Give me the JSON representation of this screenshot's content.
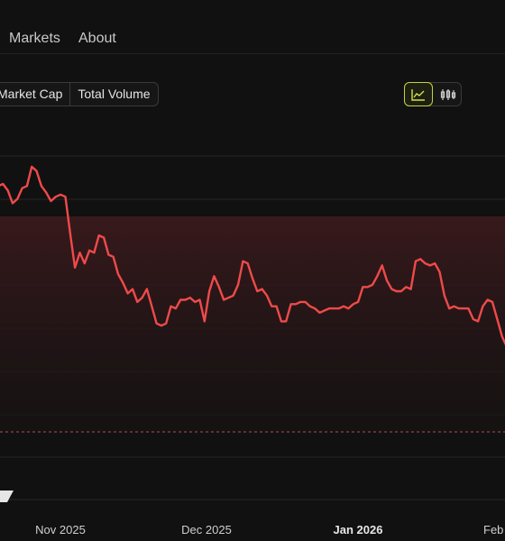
{
  "nav": {
    "items": [
      "Markets",
      "About"
    ]
  },
  "tabs": [
    "Market Cap",
    "Total Volume"
  ],
  "view_toggle": [
    {
      "icon": "line-chart-icon",
      "active": true
    },
    {
      "icon": "candlestick-chart-icon",
      "active": false
    }
  ],
  "colors": {
    "line": "#ef4a4a",
    "fill_top": "#3a1a1c",
    "reference_line": "#c0474d",
    "toggle_active": "#c8d23b"
  },
  "chart_data": {
    "type": "line",
    "x_tick_labels": [
      {
        "label": "Nov 2025",
        "bold": false
      },
      {
        "label": "Dec 2025",
        "bold": false
      },
      {
        "label": "Jan 2026",
        "bold": true
      },
      {
        "label": "Feb",
        "bold": false
      }
    ],
    "grid": true,
    "y_ticks_visible": false,
    "reference_line": {
      "style": "dashed"
    },
    "series": [
      {
        "values": [
          73,
          73.5,
          72,
          69,
          70,
          72.5,
          73,
          77.5,
          76.5,
          73,
          71.5,
          69.5,
          70.5,
          71,
          70.5,
          62,
          54,
          57.5,
          55,
          58,
          57.5,
          61.5,
          61,
          57,
          56.5,
          52.5,
          50.5,
          48,
          49,
          46,
          47,
          49,
          45,
          41,
          40.5,
          41,
          45,
          44.5,
          46.5,
          46.5,
          47,
          46,
          46.5,
          41.5,
          48.5,
          52,
          49.5,
          46.5,
          47,
          47.5,
          50,
          55.5,
          55,
          51.5,
          48.5,
          49,
          47.5,
          45,
          45,
          41.5,
          41.5,
          45.5,
          45.5,
          46,
          46,
          45,
          44.5,
          43.5,
          44,
          44.5,
          44.5,
          44.5,
          45,
          44.5,
          45.5,
          46,
          49.5,
          49.5,
          50,
          52,
          54.5,
          51,
          49,
          48.5,
          48.5,
          49.5,
          49,
          55.5,
          56,
          55,
          54.5,
          55,
          53,
          47.5,
          44.5,
          45,
          44.5,
          44.5,
          44.5,
          42,
          41.5,
          45,
          46.5,
          46,
          42,
          38,
          35.5
        ]
      }
    ]
  }
}
